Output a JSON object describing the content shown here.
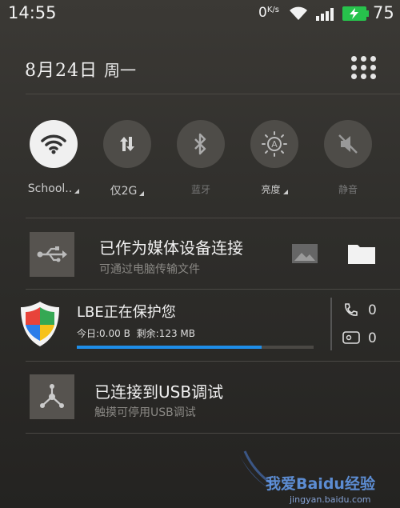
{
  "status_bar": {
    "time": "14:55",
    "net_speed": "0",
    "net_unit": "K/s",
    "battery_level": "75",
    "icons": [
      "wifi-icon",
      "signal-icon",
      "battery-charging-icon"
    ]
  },
  "header": {
    "date": "8月24日",
    "weekday": "周一",
    "grid_icon": "app-grid-icon"
  },
  "toggles": [
    {
      "label": "School..",
      "icon": "wifi-icon",
      "state": "on",
      "has_menu": true
    },
    {
      "label": "仅2G",
      "icon": "mobile-data-icon",
      "state": "off",
      "has_menu": true
    },
    {
      "label": "蓝牙",
      "icon": "bluetooth-icon",
      "state": "off",
      "has_menu": false
    },
    {
      "label": "亮度",
      "icon": "brightness-auto-icon",
      "state": "off",
      "has_menu": true
    },
    {
      "label": "静音",
      "icon": "mute-icon",
      "state": "off",
      "has_menu": false
    }
  ],
  "notifications": {
    "usb_media": {
      "title": "已作为媒体设备连接",
      "subtitle": "可通过电脑传输文件",
      "icon": "usb-icon",
      "actions": [
        "image-icon",
        "folder-icon"
      ]
    },
    "lbe": {
      "title": "LBE正在保护您",
      "today_label": "今日:0.00 B",
      "remain_label": "剩余:123 MB",
      "progress": 0.78,
      "call_count": "0",
      "sms_count": "0",
      "icon": "shield-icon"
    },
    "usb_debug": {
      "title": "已连接到USB调试",
      "subtitle": "触摸可停用USB调试",
      "icon": "debug-icon"
    }
  },
  "watermark": {
    "text": "我爱Baidu经验",
    "url": "jingyan.baidu.com"
  },
  "colors": {
    "accent": "#1e8ee8",
    "toggle_on": "#f0f0f0",
    "toggle_off": "#4e4c48"
  }
}
